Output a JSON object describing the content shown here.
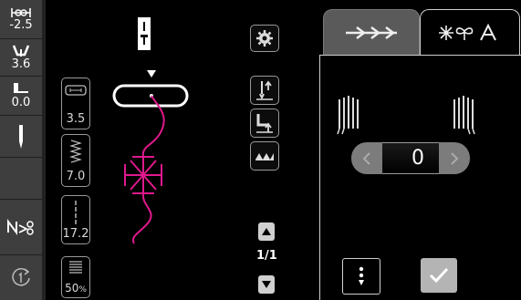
{
  "rail": {
    "width_value": "-2.5",
    "tension_value": "3.6",
    "presser_value": "0.0"
  },
  "tiles": {
    "length": "3.5",
    "width": "7.0",
    "length2": "17.2",
    "density": "50",
    "density_unit": "%"
  },
  "pager": {
    "page": "1/1"
  },
  "panel": {
    "value": "0"
  },
  "colors": {
    "accent_pattern": "#e0198c",
    "confirm_button": "#b4b4b4",
    "arrow_button": "#7c7c7c"
  },
  "icons": [
    "mirror-width-icon",
    "tension-icon",
    "presser-icon",
    "needle-icon",
    "thread-cut-icon",
    "restart-icon",
    "presser-foot-icon",
    "gear-icon",
    "stitch-tab-icon",
    "alpha-tab-icon",
    "needle-position-icon",
    "checkmark-icon"
  ]
}
